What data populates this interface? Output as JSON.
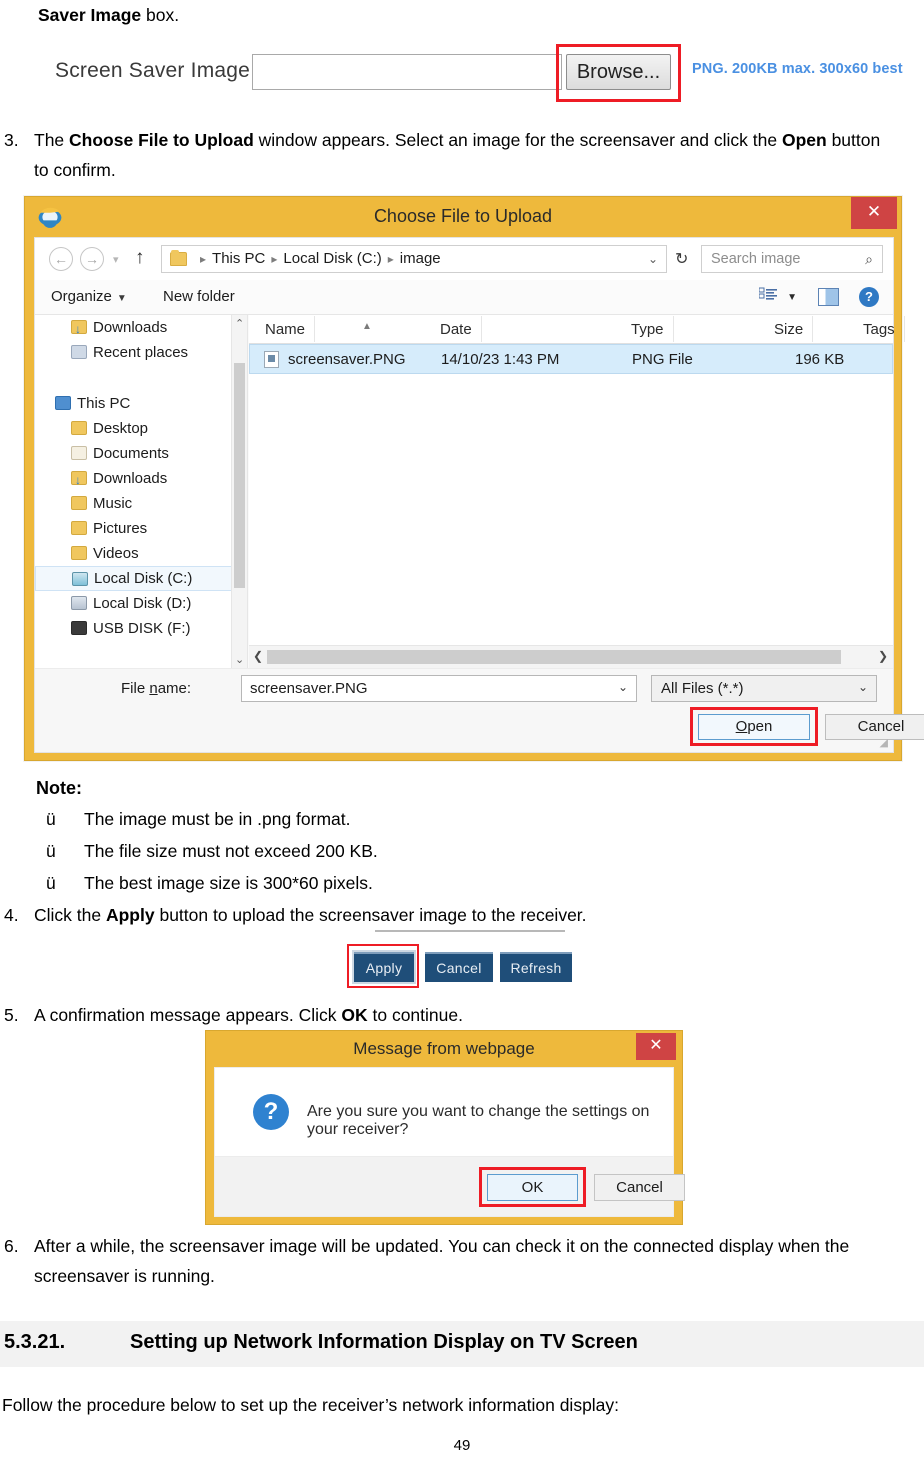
{
  "document": {
    "intro_bold": "Saver Image",
    "intro_rest": " box.",
    "page_number": "49"
  },
  "screen_saver_row": {
    "label": "Screen Saver Image",
    "input_value": "",
    "browse_label": "Browse...",
    "hint": "PNG. 200KB max. 300x60 best"
  },
  "step3": {
    "number": "3.",
    "pre": "The ",
    "bold1": "Choose File to Upload",
    "mid": " window appears. Select an image for the screensaver and click the ",
    "bold2": "Open",
    "post": " button to confirm."
  },
  "file_dialog": {
    "title": "Choose File to Upload",
    "close_label": "✕",
    "ie_icon": "internet-explorer-icon",
    "address": {
      "back_icon": "←",
      "forward_icon": "→",
      "history_caret": "▾",
      "up_icon": "↑",
      "crumbs": [
        "This PC",
        "Local Disk (C:)",
        "image"
      ],
      "separator": "▸",
      "dropdown_caret": "⌄",
      "refresh_icon": "↻",
      "search_placeholder": "Search image",
      "search_icon": "⌕"
    },
    "commandbar": {
      "organize": "Organize",
      "organize_caret": "▼",
      "new_folder": "New folder",
      "view_icon": "view-list-icon",
      "view_caret": "▼",
      "preview_pane_icon": "preview-pane-icon",
      "help_icon": "?"
    },
    "tree": [
      {
        "label": "Downloads",
        "icon": "folder-download-icon",
        "indent": true,
        "selected": false
      },
      {
        "label": "Recent places",
        "icon": "recent-places-icon",
        "indent": true,
        "selected": false
      },
      {
        "label": "",
        "icon": "spacer",
        "indent": false,
        "selected": false
      },
      {
        "label": "This PC",
        "icon": "this-pc-icon",
        "indent": false,
        "selected": false
      },
      {
        "label": "Desktop",
        "icon": "desktop-folder-icon",
        "indent": true,
        "selected": false
      },
      {
        "label": "Documents",
        "icon": "documents-folder-icon",
        "indent": true,
        "selected": false
      },
      {
        "label": "Downloads",
        "icon": "folder-download-icon",
        "indent": true,
        "selected": false
      },
      {
        "label": "Music",
        "icon": "music-folder-icon",
        "indent": true,
        "selected": false
      },
      {
        "label": "Pictures",
        "icon": "pictures-folder-icon",
        "indent": true,
        "selected": false
      },
      {
        "label": "Videos",
        "icon": "videos-folder-icon",
        "indent": true,
        "selected": false
      },
      {
        "label": "Local Disk (C:)",
        "icon": "local-disk-c-icon",
        "indent": true,
        "selected": true
      },
      {
        "label": "Local Disk (D:)",
        "icon": "local-disk-d-icon",
        "indent": true,
        "selected": false
      },
      {
        "label": "USB DISK (F:)",
        "icon": "usb-disk-icon",
        "indent": true,
        "selected": false
      }
    ],
    "columns": [
      "Name",
      "Date",
      "Type",
      "Size",
      "Tags"
    ],
    "rows": [
      {
        "name": "screensaver.PNG",
        "date": "14/10/23 1:43 PM",
        "type": "PNG File",
        "size": "196 KB",
        "tags": ""
      }
    ],
    "footer": {
      "file_name_label": "File name:",
      "file_name_value": "screensaver.PNG",
      "file_type_value": "All Files (*.*)",
      "open_label": "Open",
      "cancel_label": "Cancel"
    }
  },
  "note": {
    "title": "Note:",
    "marker": "ü",
    "items": [
      "The image must be in .png format.",
      "The file size must not exceed 200 KB.",
      "The best image size is 300*60 pixels."
    ]
  },
  "step4": {
    "number": "4.",
    "pre": "Click the ",
    "bold1": "Apply",
    "post": " button to upload the screensaver image to the receiver."
  },
  "web_buttons": {
    "apply": "Apply",
    "cancel": "Cancel",
    "refresh": "Refresh"
  },
  "step5": {
    "number": "5.",
    "pre": "A confirmation message appears. Click ",
    "bold1": "OK",
    "post": " to continue."
  },
  "message_dialog": {
    "title": "Message from webpage",
    "close_label": "✕",
    "question_icon": "?",
    "message": "Are you sure you want to change the settings on your receiver?",
    "ok_label": "OK",
    "cancel_label": "Cancel"
  },
  "step6": {
    "number": "6.",
    "text": "After a while, the screensaver image will be updated. You can check it on the connected display when the screensaver is running."
  },
  "section": {
    "number": "5.3.21.",
    "title": "Setting up Network Information Display on TV Screen"
  },
  "follow_text": "Follow the procedure below to set up the receiver’s network information display:",
  "colors": {
    "highlight_red": "#ee1c25",
    "dialog_gold": "#eeb93c",
    "close_red": "#cf4444",
    "web_button_blue": "#1f4e79",
    "hint_blue": "#4a90e2",
    "selection_blue": "#d6ecfb",
    "section_grey": "#f2f2f2"
  }
}
